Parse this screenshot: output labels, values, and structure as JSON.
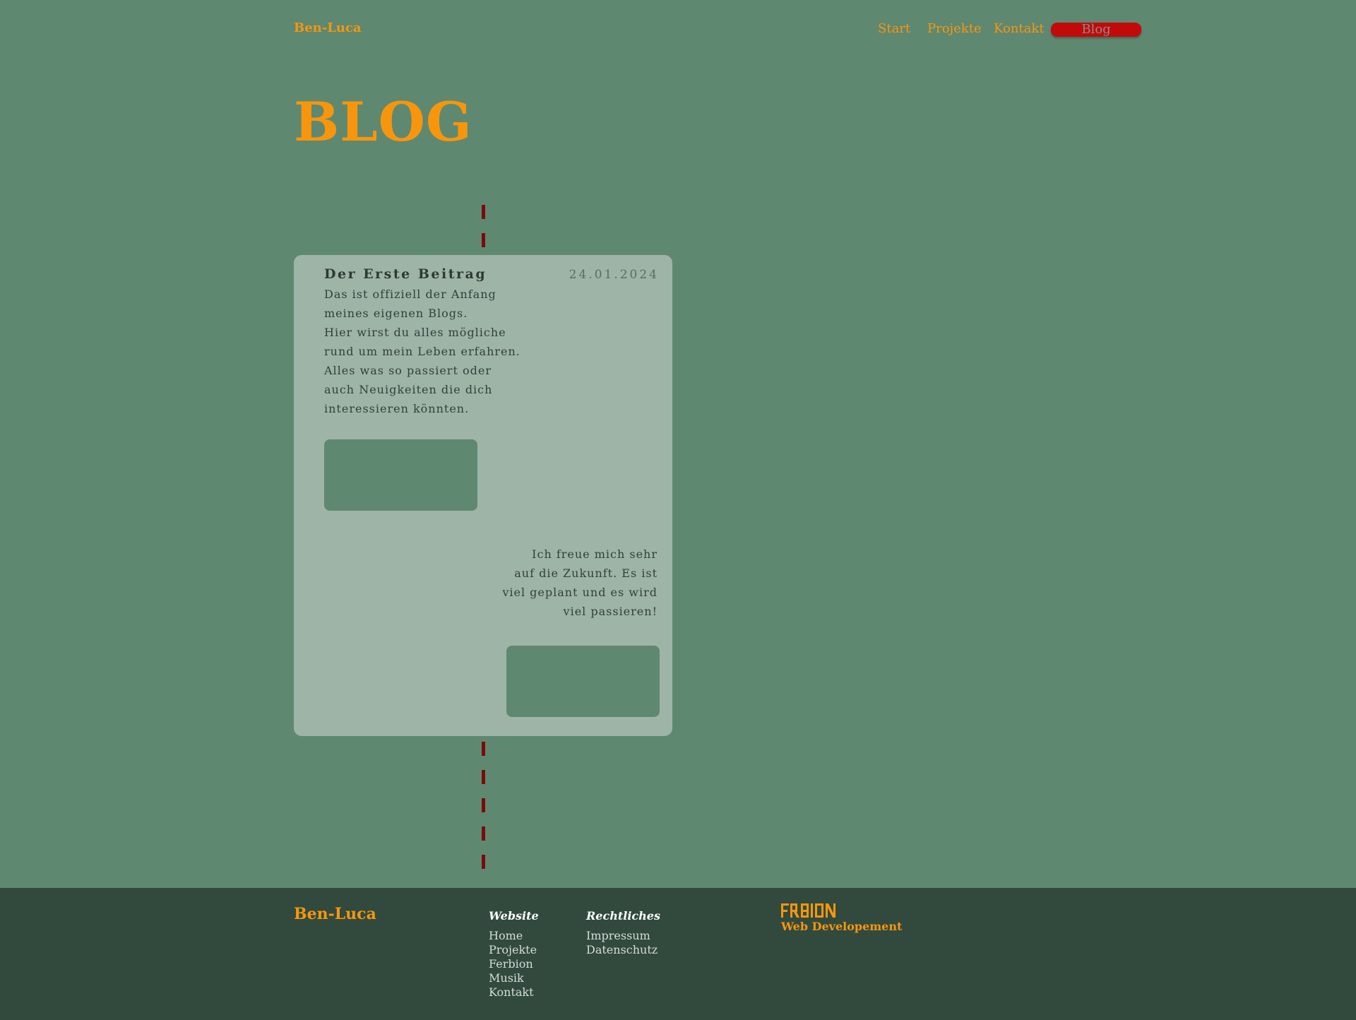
{
  "header": {
    "brand": "Ben-Luca",
    "nav": {
      "start": "Start",
      "projekte": "Projekte",
      "kontakt": "Kontakt",
      "blog": "Blog"
    }
  },
  "page": {
    "title": "BLOG"
  },
  "post": {
    "title": "Der Erste Beitrag",
    "date": "24.01.2024",
    "paragraph1": [
      "Das ist offiziell der Anfang",
      "meines eigenen Blogs.",
      "Hier wirst du alles mögliche",
      "rund um mein Leben erfahren.",
      "Alles was so passiert oder",
      "auch Neuigkeiten die dich",
      "interessieren könnten."
    ],
    "paragraph2": [
      "Ich freue mich sehr",
      "auf die Zukunft. Es ist",
      "viel geplant und es wird",
      "viel passieren!"
    ]
  },
  "footer": {
    "brand": "Ben-Luca",
    "website": {
      "title": "Website",
      "links": [
        "Home",
        "Projekte",
        "Ferbion",
        "Musik",
        "Kontakt"
      ]
    },
    "legal": {
      "title": "Rechtliches",
      "links": [
        "Impressum",
        "Datenschutz"
      ]
    },
    "ferbion": {
      "logo_text": "FERBION",
      "tagline": "Web Developement"
    }
  },
  "colors": {
    "background": "#5f8871",
    "accent": "#f7960c",
    "card": "#9eb4a7",
    "timeline": "#7d0a0a",
    "active_nav": "#c30a0a",
    "footer": "#314a3d"
  }
}
